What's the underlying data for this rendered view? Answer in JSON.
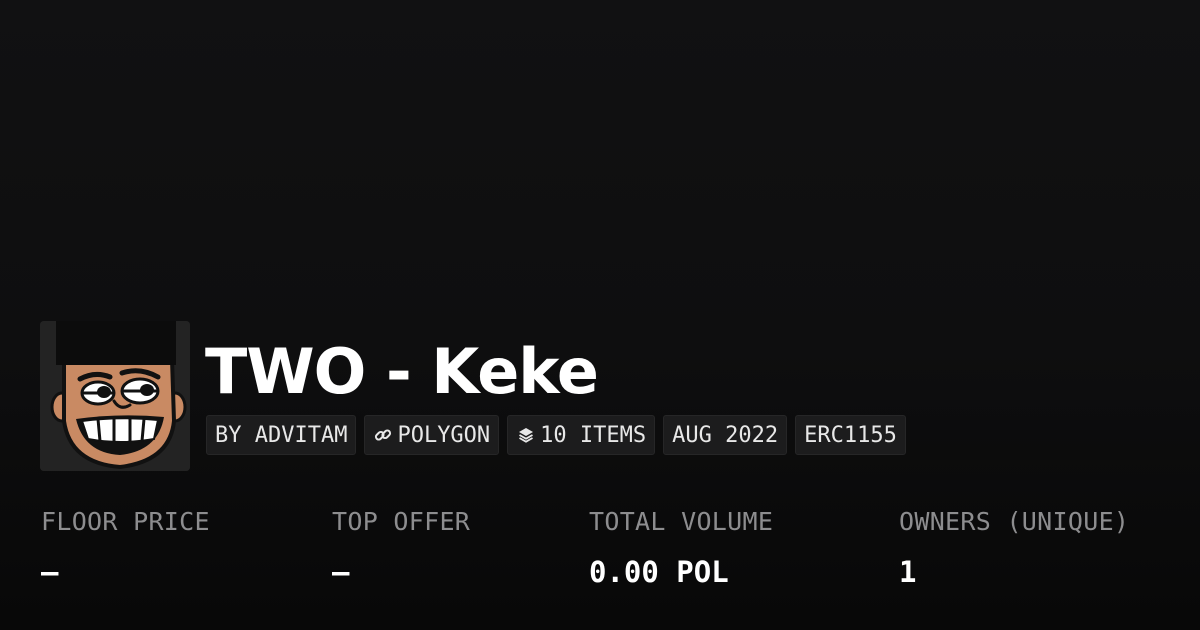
{
  "collection": {
    "title": "TWO - Keke",
    "avatar_icon": "cartoon-face-avatar"
  },
  "tags": [
    {
      "label": "BY ADVITAM",
      "icon": ""
    },
    {
      "label": "POLYGON",
      "icon": "link-icon"
    },
    {
      "label": "10 ITEMS",
      "icon": "layers-icon"
    },
    {
      "label": "AUG 2022",
      "icon": ""
    },
    {
      "label": "ERC1155",
      "icon": ""
    }
  ],
  "stats": [
    {
      "label": "FLOOR PRICE",
      "value": "–"
    },
    {
      "label": "TOP OFFER",
      "value": "–"
    },
    {
      "label": "TOTAL VOLUME",
      "value": "0.00 POL"
    },
    {
      "label": "OWNERS (UNIQUE)",
      "value": "1"
    }
  ],
  "colors": {
    "background": "#0e0e0f",
    "tag_background": "#1c1c1d",
    "label_gray": "#8d8d8f",
    "text_white": "#ffffff",
    "avatar_skin": "#c98a63"
  }
}
